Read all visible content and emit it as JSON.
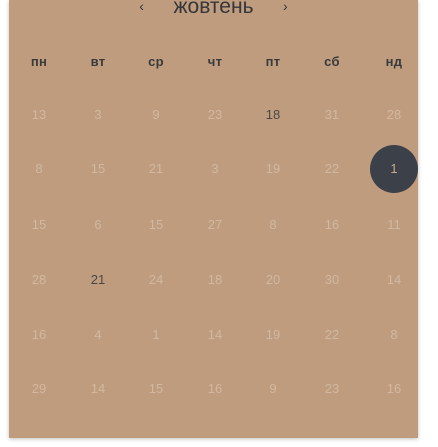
{
  "calendar": {
    "month_title": "жовтень",
    "prev_icon": "‹",
    "next_icon": "›",
    "weekdays": [
      "пн",
      "вт",
      "ср",
      "чт",
      "пт",
      "сб",
      "нд"
    ],
    "weeks": [
      [
        "13",
        "3",
        "9",
        "23",
        "18",
        "31",
        "28"
      ],
      [
        "8",
        "15",
        "21",
        "3",
        "19",
        "22",
        "1"
      ],
      [
        "15",
        "6",
        "15",
        "27",
        "8",
        "16",
        "11"
      ],
      [
        "28",
        "21",
        "24",
        "18",
        "20",
        "30",
        "14"
      ],
      [
        "16",
        "4",
        "1",
        "14",
        "19",
        "22",
        "8"
      ],
      [
        "29",
        "14",
        "15",
        "16",
        "9",
        "23",
        "16"
      ]
    ],
    "highlighted": [
      [
        0,
        4
      ],
      [
        3,
        1
      ]
    ],
    "selected": [
      1,
      6
    ]
  }
}
